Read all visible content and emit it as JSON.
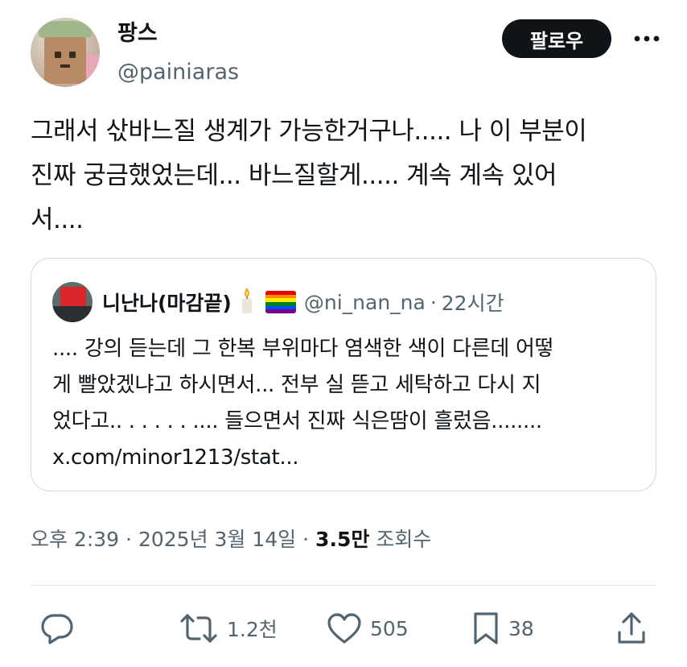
{
  "author": {
    "display_name": "팡스",
    "handle": "@painiaras",
    "avatar_icon": "avatar-icon"
  },
  "follow_label": "팔로우",
  "more_icon": "more-horizontal-icon",
  "tweet_text": "그래서 삯바느질 생계가 가능한거구나..... 나 이 부분이\n진짜 궁금했었는데... 바느질할게..... 계속 계속 있어\n서....",
  "quote": {
    "display_name": "니난나(마감끝)",
    "candle_emoji": "🕯️",
    "flag_emoji": "rainbow-flag",
    "handle": "@ni_nan_na",
    "separator": "·",
    "time": "22시간",
    "text": ".... 강의 듣는데 그 한복 부위마다 염색한 색이 다른데 어떻\n게 빨았겠냐고 하시면서... 전부 실 뜯고 세탁하고 다시 지\n었다고.. . . . . . .... 들으면서 진짜 식은땀이 흘렀음........\nx.com/minor1213/stat..."
  },
  "meta": {
    "time": "오후 2:39",
    "sep1": "·",
    "date": "2025년 3월 14일",
    "sep2": "·",
    "views_count": "3.5만",
    "views_label": "조회수"
  },
  "actions": {
    "reply_icon": "reply-icon",
    "retweet_count": "1.2천",
    "like_count": "505",
    "bookmark_count": "38",
    "share_icon": "share-icon"
  },
  "colors": {
    "text": "#0f1419",
    "secondary": "#536471",
    "border": "#cfd9de",
    "follow_bg": "#0f1419"
  }
}
